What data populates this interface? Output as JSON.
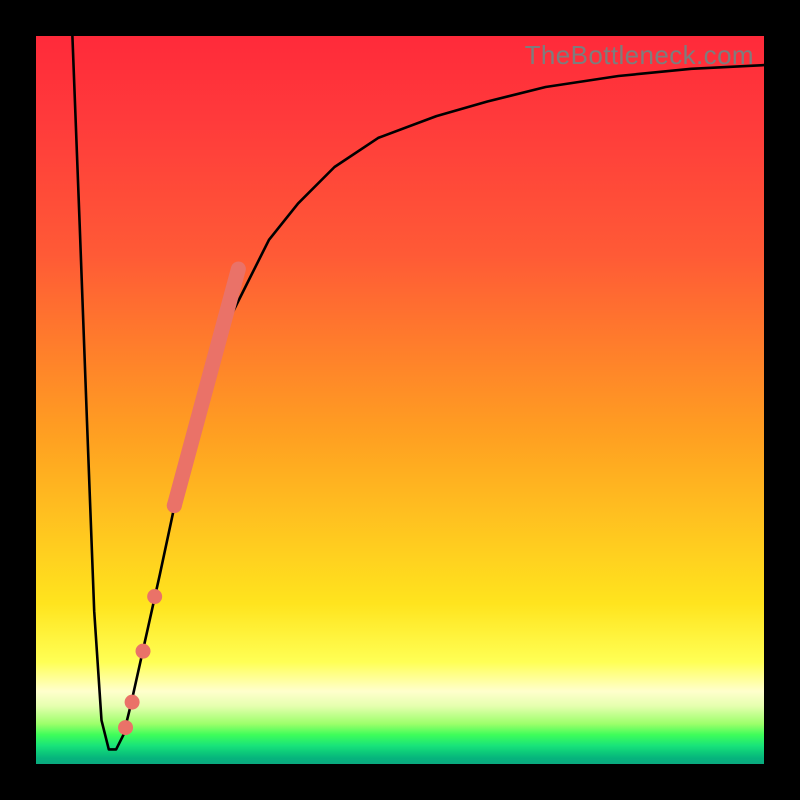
{
  "watermark": "TheBottleneck.com",
  "chart_data": {
    "type": "line",
    "title": "",
    "xlabel": "",
    "ylabel": "",
    "xlim": [
      0,
      100
    ],
    "ylim": [
      0,
      100
    ],
    "series": [
      {
        "name": "curve",
        "x": [
          5,
          6,
          7,
          8,
          9,
          10,
          11,
          12,
          13,
          15,
          17,
          20,
          22,
          24,
          26,
          29,
          32,
          36,
          41,
          47,
          55,
          62,
          70,
          80,
          90,
          100
        ],
        "y": [
          100,
          74,
          47,
          21,
          6,
          2,
          2,
          4,
          8,
          17,
          26,
          40,
          48,
          54,
          60,
          66,
          72,
          77,
          82,
          86,
          89,
          91,
          93,
          94.5,
          95.5,
          96
        ]
      }
    ],
    "dots": {
      "name": "highlight-dots",
      "color": "#ea7268",
      "x": [
        12.3,
        13.2,
        14.7,
        16.3,
        19.0,
        19.9,
        20.7,
        21.4,
        22.1,
        22.8,
        23.5,
        24.2,
        24.9,
        25.6,
        26.3,
        27.0
      ],
      "y": [
        5.0,
        8.5,
        15.5,
        23.0,
        35.5,
        39.5,
        43.0,
        46.0,
        49.0,
        52.0,
        54.5,
        57.0,
        59.5,
        62.0,
        64.0,
        66.0
      ]
    },
    "segment": {
      "name": "thick-segment",
      "color": "#ea7268",
      "x": [
        19.0,
        27.8
      ],
      "y": [
        35.5,
        68.0
      ]
    }
  }
}
